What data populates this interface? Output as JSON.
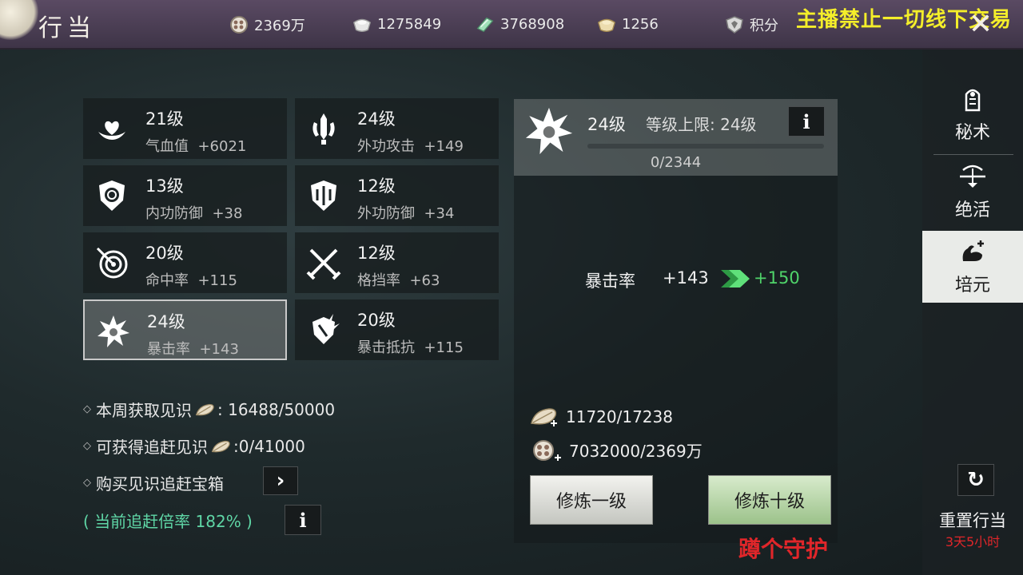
{
  "header": {
    "title": "行当",
    "currencies": [
      {
        "icon": "coin-icon",
        "value": "2369万"
      },
      {
        "icon": "silver-ingot-icon",
        "value": "1275849"
      },
      {
        "icon": "jade-icon",
        "value": "3768908"
      },
      {
        "icon": "gold-ingot-icon",
        "value": "1256"
      },
      {
        "icon": "shield-badge-icon",
        "value": "积分"
      }
    ],
    "stream_warning": "主播禁止一切线下交易"
  },
  "stats": [
    {
      "level": "21级",
      "name": "气血值",
      "bonus": "+6021",
      "icon": "heart-lotus-icon"
    },
    {
      "level": "24级",
      "name": "外功攻击",
      "bonus": "+149",
      "icon": "sword-emblem-icon"
    },
    {
      "level": "13级",
      "name": "内功防御",
      "bonus": "+38",
      "icon": "round-shield-icon"
    },
    {
      "level": "12级",
      "name": "外功防御",
      "bonus": "+34",
      "icon": "armor-shield-icon"
    },
    {
      "level": "20级",
      "name": "命中率",
      "bonus": "+115",
      "icon": "target-icon"
    },
    {
      "level": "12级",
      "name": "格挡率",
      "bonus": "+63",
      "icon": "crossed-swords-icon"
    },
    {
      "level": "24级",
      "name": "暴击率",
      "bonus": "+143",
      "icon": "burst-icon"
    },
    {
      "level": "20级",
      "name": "暴击抵抗",
      "bonus": "+115",
      "icon": "spiked-shield-icon"
    }
  ],
  "detail": {
    "level": "24级",
    "cap_label": "等级上限: 24级",
    "progress_text": "0/2344",
    "progress": 0,
    "stat_name": "暴击率",
    "current": "+143",
    "next": "+150",
    "cost_insight": "11720/17238",
    "cost_coin": "7032000/2369万",
    "btn_one": "修炼一级",
    "btn_ten": "修炼十级"
  },
  "weekly": {
    "obtained_label": "本周获取见识",
    "obtained_value": ": 16488/50000",
    "catchup_label": "可获得追赶见识",
    "catchup_value": ":0/41000",
    "buy_label": "购买见识追赶宝箱",
    "rate_text": "( 当前追赶倍率  182% )"
  },
  "sidebar": {
    "items": [
      {
        "label": "秘术",
        "icon": "secret-art-icon"
      },
      {
        "label": "绝活",
        "icon": "bow-icon"
      },
      {
        "label": "培元",
        "icon": "muscle-arm-icon"
      }
    ],
    "reset_label": "重置行当",
    "reset_timer": "3天5小时"
  },
  "overlay_text": "蹲个守护",
  "colors": {
    "green_value": "#4fd46a",
    "warn_yellow": "#f4ee2a",
    "red_text": "#e0262a"
  }
}
